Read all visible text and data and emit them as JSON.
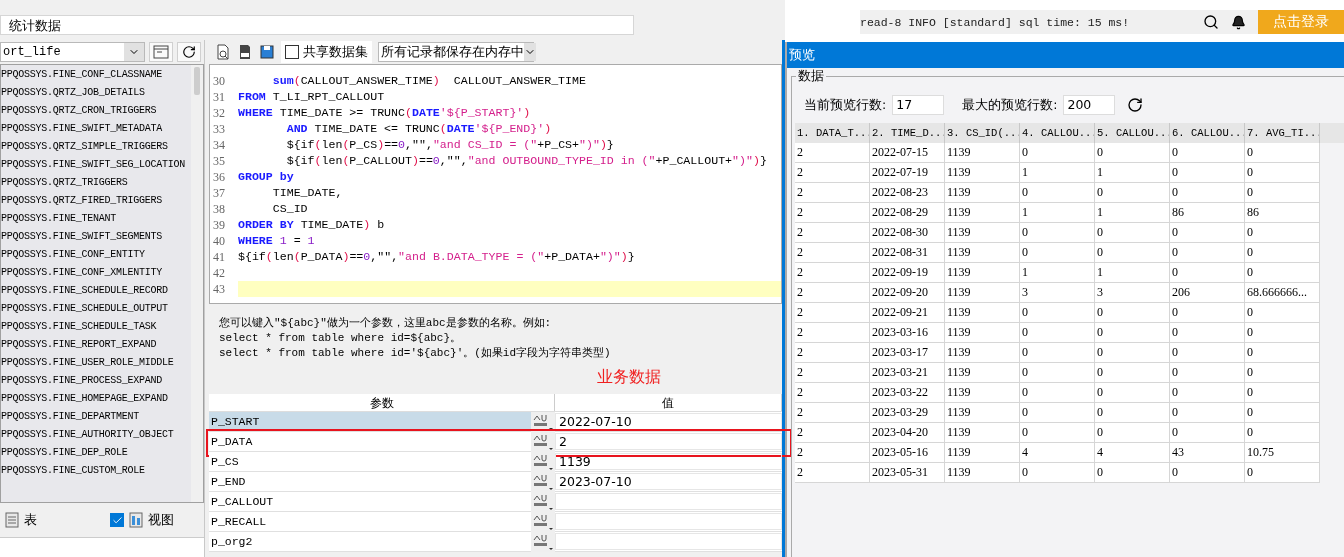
{
  "dataset_name": "统计数据",
  "connection": {
    "value": "ort_life"
  },
  "tables": [
    "PPQOSSYS.FINE_CONF_CLASSNAME",
    "PPQOSSYS.QRTZ_JOB_DETAILS",
    "PPQOSSYS.QRTZ_CRON_TRIGGERS",
    "PPQOSSYS.FINE_SWIFT_METADATA",
    "PPQOSSYS.QRTZ_SIMPLE_TRIGGERS",
    "PPQOSSYS.FINE_SWIFT_SEG_LOCATION",
    "PPQOSSYS.QRTZ_TRIGGERS",
    "PPQOSSYS.QRTZ_FIRED_TRIGGERS",
    "PPQOSSYS.FINE_TENANT",
    "PPQOSSYS.FINE_SWIFT_SEGMENTS",
    "PPQOSSYS.FINE_CONF_ENTITY",
    "PPQOSSYS.FINE_CONF_XMLENTITY",
    "PPQOSSYS.FINE_SCHEDULE_RECORD",
    "PPQOSSYS.FINE_SCHEDULE_OUTPUT",
    "PPQOSSYS.FINE_SCHEDULE_TASK",
    "PPQOSSYS.FINE_REPORT_EXPAND",
    "PPQOSSYS.FINE_USER_ROLE_MIDDLE",
    "PPQOSSYS.FINE_PROCESS_EXPAND",
    "PPQOSSYS.FINE_HOMEPAGE_EXPAND",
    "PPQOSSYS.FINE_DEPARTMENT",
    "PPQOSSYS.FINE_AUTHORITY_OBJECT",
    "PPQOSSYS.FINE_DEP_ROLE",
    "PPQOSSYS.FINE_CUSTOM_ROLE"
  ],
  "filters": [
    {
      "label": "表",
      "kind": "plain"
    },
    {
      "label": "视图",
      "kind": "checkbox",
      "checked": true
    }
  ],
  "toolbar": {
    "share_checkbox": {
      "label": "共享数据集",
      "checked": false
    },
    "storage_select": {
      "value": "所有记录都保存在内存中"
    }
  },
  "code_lines": [
    {
      "number": "30",
      "current": false,
      "segments": [
        {
          "kind": "kw",
          "text": "     sum"
        },
        {
          "kind": "op",
          "text": "("
        },
        {
          "kind": "plain",
          "text": "CALLOUT_ANSWER_TIME"
        },
        {
          "kind": "op",
          "text": ")"
        },
        {
          "kind": "plain",
          "text": "  CALLOUT_ANSWER_TIME"
        }
      ]
    },
    {
      "number": "31",
      "current": false,
      "segments": [
        {
          "kind": "kw",
          "text": "FROM"
        },
        {
          "kind": "plain",
          "text": " T_LI_RPT_CALLOUT"
        }
      ]
    },
    {
      "number": "32",
      "current": false,
      "segments": [
        {
          "kind": "kw",
          "text": "WHERE"
        },
        {
          "kind": "plain",
          "text": " TIME_DATE >= TRUNC"
        },
        {
          "kind": "op",
          "text": "("
        },
        {
          "kind": "kw",
          "text": "DATE"
        },
        {
          "kind": "str",
          "text": "'${P_START}'"
        },
        {
          "kind": "op",
          "text": ")"
        }
      ]
    },
    {
      "number": "33",
      "current": false,
      "segments": [
        {
          "kind": "kw",
          "text": "       AND"
        },
        {
          "kind": "plain",
          "text": " TIME_DATE <= TRUNC"
        },
        {
          "kind": "op",
          "text": "("
        },
        {
          "kind": "kw",
          "text": "DATE"
        },
        {
          "kind": "str",
          "text": "'${P_END}'"
        },
        {
          "kind": "op",
          "text": ")"
        }
      ]
    },
    {
      "number": "34",
      "current": false,
      "segments": [
        {
          "kind": "plain",
          "text": "       ${if"
        },
        {
          "kind": "op",
          "text": "("
        },
        {
          "kind": "plain",
          "text": "len"
        },
        {
          "kind": "op",
          "text": "("
        },
        {
          "kind": "plain",
          "text": "P_CS"
        },
        {
          "kind": "op",
          "text": ")"
        },
        {
          "kind": "plain",
          "text": "=="
        },
        {
          "kind": "num",
          "text": "0"
        },
        {
          "kind": "plain",
          "text": ",\"\","
        },
        {
          "kind": "str",
          "text": "\"and CS_ID = (\""
        },
        {
          "kind": "plain",
          "text": "+P_CS+"
        },
        {
          "kind": "str",
          "text": "\")\""
        },
        {
          "kind": "op",
          "text": ")"
        },
        {
          "kind": "plain",
          "text": "}"
        }
      ]
    },
    {
      "number": "35",
      "current": false,
      "segments": [
        {
          "kind": "plain",
          "text": "       ${if"
        },
        {
          "kind": "op",
          "text": "("
        },
        {
          "kind": "plain",
          "text": "len"
        },
        {
          "kind": "op",
          "text": "("
        },
        {
          "kind": "plain",
          "text": "P_CALLOUT"
        },
        {
          "kind": "op",
          "text": ")"
        },
        {
          "kind": "plain",
          "text": "=="
        },
        {
          "kind": "num",
          "text": "0"
        },
        {
          "kind": "plain",
          "text": ",\"\","
        },
        {
          "kind": "str",
          "text": "\"and OUTBOUND_TYPE_ID in (\""
        },
        {
          "kind": "plain",
          "text": "+P_CALLOUT+"
        },
        {
          "kind": "str",
          "text": "\")\""
        },
        {
          "kind": "op",
          "text": ")"
        },
        {
          "kind": "plain",
          "text": "}"
        }
      ]
    },
    {
      "number": "36",
      "current": false,
      "segments": [
        {
          "kind": "kw",
          "text": "GROUP by"
        }
      ]
    },
    {
      "number": "37",
      "current": false,
      "segments": [
        {
          "kind": "plain",
          "text": "     TIME_DATE,"
        }
      ]
    },
    {
      "number": "38",
      "current": false,
      "segments": [
        {
          "kind": "plain",
          "text": "     CS_ID"
        }
      ]
    },
    {
      "number": "39",
      "current": false,
      "segments": [
        {
          "kind": "kw",
          "text": "ORDER BY"
        },
        {
          "kind": "plain",
          "text": " TIME_DATE"
        },
        {
          "kind": "op",
          "text": ")"
        },
        {
          "kind": "plain",
          "text": " b"
        }
      ]
    },
    {
      "number": "40",
      "current": false,
      "segments": [
        {
          "kind": "kw",
          "text": "WHERE "
        },
        {
          "kind": "num",
          "text": "1"
        },
        {
          "kind": "plain",
          "text": " = "
        },
        {
          "kind": "num",
          "text": "1"
        }
      ]
    },
    {
      "number": "41",
      "current": false,
      "segments": [
        {
          "kind": "plain",
          "text": "${if"
        },
        {
          "kind": "op",
          "text": "("
        },
        {
          "kind": "plain",
          "text": "len"
        },
        {
          "kind": "op",
          "text": "("
        },
        {
          "kind": "plain",
          "text": "P_DATA"
        },
        {
          "kind": "op",
          "text": ")"
        },
        {
          "kind": "plain",
          "text": "=="
        },
        {
          "kind": "num",
          "text": "0"
        },
        {
          "kind": "plain",
          "text": ",\"\","
        },
        {
          "kind": "str",
          "text": "\"and B.DATA_TYPE = (\""
        },
        {
          "kind": "plain",
          "text": "+P_DATA+"
        },
        {
          "kind": "str",
          "text": "\")\""
        },
        {
          "kind": "op",
          "text": ")"
        },
        {
          "kind": "plain",
          "text": "}"
        }
      ]
    },
    {
      "number": "42",
      "current": false
    },
    {
      "number": "43",
      "current": true
    }
  ],
  "hint": [
    "您可以键入\"${abc}\"做为一个参数，这里abc是参数的名称。例如:",
    "select * from table where id=${abc}。",
    "select * from table where id='${abc}'。(如果id字段为字符串类型)"
  ],
  "annotation": "业务数据",
  "parameters": {
    "columns": [
      "参数",
      "值"
    ],
    "rows": [
      {
        "name": "P_START",
        "value": "2022-07-10",
        "selected": true,
        "outlined": false
      },
      {
        "name": "P_DATA",
        "value": "2",
        "selected": false,
        "outlined": true
      },
      {
        "name": "P_CS",
        "value": "1139",
        "selected": false,
        "outlined": false
      },
      {
        "name": "P_END",
        "value": "2023-07-10",
        "selected": false,
        "outlined": false
      },
      {
        "name": "P_CALLOUT",
        "selected": false,
        "outlined": false
      },
      {
        "name": "P_RECALL",
        "selected": false,
        "outlined": false
      },
      {
        "name": "p_org2",
        "selected": false,
        "outlined": false
      }
    ]
  },
  "background_app": {
    "log": "read-8 INFO [standard] sql time: 15 ms!",
    "login_button": "点击登录"
  },
  "preview": {
    "title": "预览",
    "group": "数据",
    "current_rows_label": "当前预览行数:",
    "current_rows": "17",
    "max_rows_label": "最大的预览行数:",
    "max_rows": "200",
    "columns": [
      "1. DATA_T...",
      "2. TIME_D...",
      "3. CS_ID(...",
      "4. CALLOU...",
      "5. CALLOU...",
      "6. CALLOU...",
      "7. AVG_TI..."
    ],
    "rows": [
      [
        "2",
        "2022-07-15",
        "1139",
        "0",
        "0",
        "0",
        "0"
      ],
      [
        "2",
        "2022-07-19",
        "1139",
        "1",
        "1",
        "0",
        "0"
      ],
      [
        "2",
        "2022-08-23",
        "1139",
        "0",
        "0",
        "0",
        "0"
      ],
      [
        "2",
        "2022-08-29",
        "1139",
        "1",
        "1",
        "86",
        "86"
      ],
      [
        "2",
        "2022-08-30",
        "1139",
        "0",
        "0",
        "0",
        "0"
      ],
      [
        "2",
        "2022-08-31",
        "1139",
        "0",
        "0",
        "0",
        "0"
      ],
      [
        "2",
        "2022-09-19",
        "1139",
        "1",
        "1",
        "0",
        "0"
      ],
      [
        "2",
        "2022-09-20",
        "1139",
        "3",
        "3",
        "206",
        "68.666666..."
      ],
      [
        "2",
        "2022-09-21",
        "1139",
        "0",
        "0",
        "0",
        "0"
      ],
      [
        "2",
        "2023-03-16",
        "1139",
        "0",
        "0",
        "0",
        "0"
      ],
      [
        "2",
        "2023-03-17",
        "1139",
        "0",
        "0",
        "0",
        "0"
      ],
      [
        "2",
        "2023-03-21",
        "1139",
        "0",
        "0",
        "0",
        "0"
      ],
      [
        "2",
        "2023-03-22",
        "1139",
        "0",
        "0",
        "0",
        "0"
      ],
      [
        "2",
        "2023-03-29",
        "1139",
        "0",
        "0",
        "0",
        "0"
      ],
      [
        "2",
        "2023-04-20",
        "1139",
        "0",
        "0",
        "0",
        "0"
      ],
      [
        "2",
        "2023-05-16",
        "1139",
        "4",
        "4",
        "43",
        "10.75"
      ],
      [
        "2",
        "2023-05-31",
        "1139",
        "0",
        "0",
        "0",
        "0"
      ]
    ]
  }
}
